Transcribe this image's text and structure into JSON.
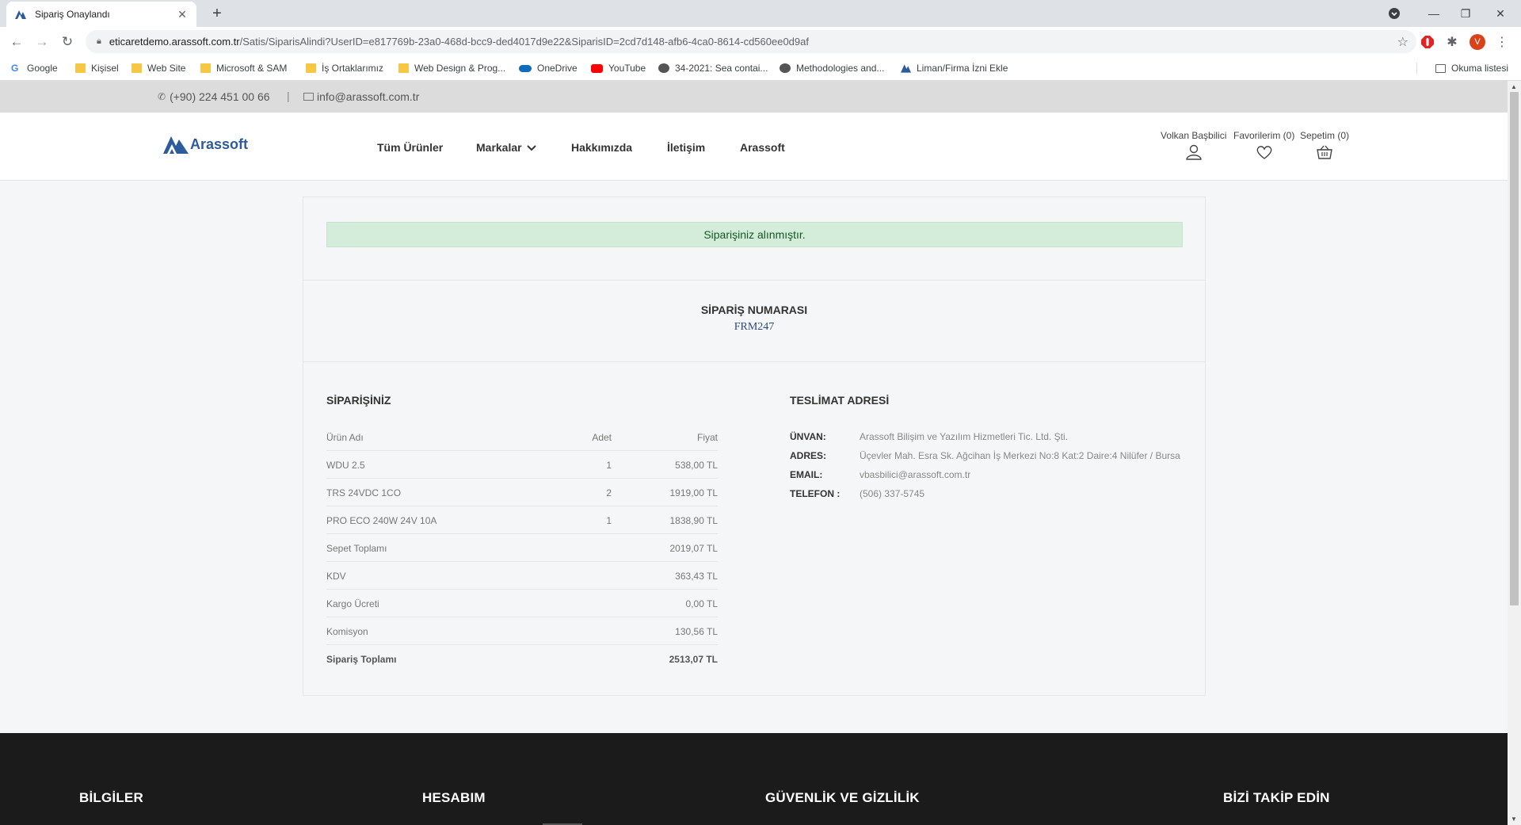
{
  "browser": {
    "tab_title": "Sipariş Onaylandı",
    "url_host": "eticaretdemo.arassoft.com.tr",
    "url_path": "/Satis/SiparisAlindi?UserID=e817769b-23a0-468d-bcc9-ded4017d9e22&SiparisID=2cd7d148-afb6-4ca0-8614-cd560ee0d9af",
    "profile_initial": "V",
    "bookmarks": [
      {
        "label": "Google",
        "icon": "google-icon"
      },
      {
        "label": "Kişisel",
        "icon": "folder-icon"
      },
      {
        "label": "Web Site",
        "icon": "folder-icon"
      },
      {
        "label": "Microsoft & SAM",
        "icon": "folder-icon"
      },
      {
        "label": "İş Ortaklarımız",
        "icon": "folder-icon"
      },
      {
        "label": "Web Design & Prog...",
        "icon": "folder-icon"
      },
      {
        "label": "OneDrive",
        "icon": "onedrive-icon"
      },
      {
        "label": "YouTube",
        "icon": "youtube-icon"
      },
      {
        "label": "34-2021: Sea contai...",
        "icon": "site-icon"
      },
      {
        "label": "Methodologies and...",
        "icon": "site-icon"
      },
      {
        "label": "Liman/Firma İzni Ekle",
        "icon": "arassoft-icon"
      }
    ],
    "reading_list": "Okuma listesi"
  },
  "topbar": {
    "phone": "(+90) 224 451 00 66",
    "separator": "|",
    "email": "info@arassoft.com.tr"
  },
  "header": {
    "logo_text": "Arassoft",
    "menu": [
      "Tüm Ürünler",
      "Markalar",
      "Hakkımızda",
      "İletişim",
      "Arassoft"
    ],
    "user": "Volkan Başbilici",
    "favorites": "Favorilerim (0)",
    "cart": "Sepetim (0)"
  },
  "confirmation": {
    "alert": "Siparişiniz alınmıştır.",
    "order_number_label": "SİPARİŞ NUMARASI",
    "order_number": "FRM247"
  },
  "order": {
    "title": "SİPARİŞİNİZ",
    "columns": [
      "Ürün Adı",
      "Adet",
      "Fiyat"
    ],
    "items": [
      {
        "name": "WDU 2.5",
        "qty": "1",
        "price": "538,00 TL"
      },
      {
        "name": "TRS 24VDC 1CO",
        "qty": "2",
        "price": "1919,00 TL"
      },
      {
        "name": "PRO ECO 240W 24V 10A",
        "qty": "1",
        "price": "1838,90 TL"
      }
    ],
    "summary": [
      {
        "label": "Sepet Toplamı",
        "value": "2019,07 TL"
      },
      {
        "label": "KDV",
        "value": "363,43 TL"
      },
      {
        "label": "Kargo Ücreti",
        "value": "0,00 TL"
      },
      {
        "label": "Komisyon",
        "value": "130,56 TL"
      },
      {
        "label": "Sipariş Toplamı",
        "value": "2513,07 TL"
      }
    ]
  },
  "delivery": {
    "title": "TESLİMAT ADRESİ",
    "fields": [
      {
        "label": "ÜNVAN:",
        "value": "Arassoft Bilişim ve Yazılım Hizmetleri Tic. Ltd. Şti."
      },
      {
        "label": "ADRES:",
        "value": "Üçevler Mah. Esra Sk. Ağcihan İş Merkezi No:8 Kat:2 Daire:4 Nilüfer / Bursa"
      },
      {
        "label": "EMAIL:",
        "value": "vbasbilici@arassoft.com.tr"
      },
      {
        "label": "TELEFON :",
        "value": "(506) 337-5745"
      }
    ]
  },
  "footer": {
    "headings": [
      "BİLGİLER",
      "HESABIM",
      "GÜVENLİK VE GİZLİLİK",
      "BİZİ TAKİP EDİN"
    ]
  },
  "colors": {
    "brand": "#2e5b9a",
    "alert_bg": "#d4edda",
    "alert_text": "#155724",
    "footer_bg": "#1b1b1b"
  }
}
